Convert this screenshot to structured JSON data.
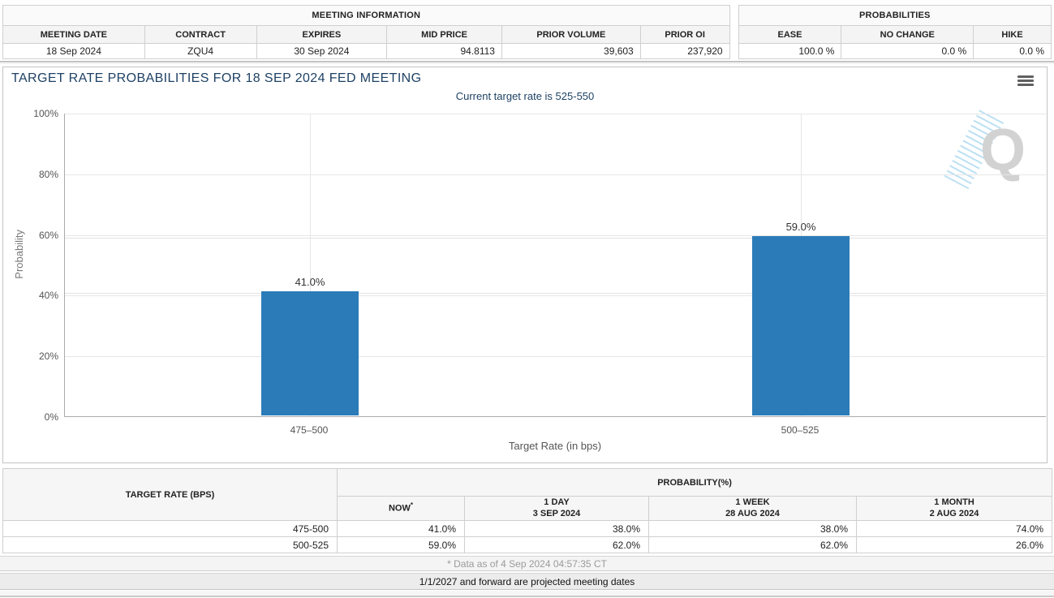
{
  "meeting_information": {
    "title": "MEETING INFORMATION",
    "columns": [
      "MEETING DATE",
      "CONTRACT",
      "EXPIRES",
      "MID PRICE",
      "PRIOR VOLUME",
      "PRIOR OI"
    ],
    "values": [
      "18 Sep 2024",
      "ZQU4",
      "30 Sep 2024",
      "94.8113",
      "39,603",
      "237,920"
    ]
  },
  "probabilities_summary": {
    "title": "PROBABILITIES",
    "columns": [
      "EASE",
      "NO CHANGE",
      "HIKE"
    ],
    "values": [
      "100.0 %",
      "0.0 %",
      "0.0 %"
    ]
  },
  "chart": {
    "title": "TARGET RATE PROBABILITIES FOR 18 SEP 2024 FED MEETING",
    "subtitle": "Current target rate is 525-550",
    "watermark_letter": "Q",
    "menu_icon": "hamburger-menu-icon"
  },
  "chart_data": {
    "type": "bar",
    "categories": [
      "475–500",
      "500–525"
    ],
    "values": [
      41.0,
      59.0
    ],
    "bar_labels": [
      "41.0%",
      "59.0%"
    ],
    "title": "TARGET RATE PROBABILITIES FOR 18 SEP 2024 FED MEETING",
    "subtitle": "Current target rate is 525-550",
    "xlabel": "Target Rate (in bps)",
    "ylabel": "Probability",
    "ylim": [
      0,
      100
    ],
    "yticks": [
      "0%",
      "20%",
      "40%",
      "60%",
      "80%",
      "100%"
    ],
    "grid": true,
    "legend": "none",
    "bar_color": "#2b7bb8"
  },
  "history_table": {
    "rate_header": "TARGET RATE (BPS)",
    "group_header": "PROBABILITY(%)",
    "now_label": "NOW",
    "now_footnote_mark": "*",
    "day_label": "1 DAY",
    "day_date": "3 SEP 2024",
    "week_label": "1 WEEK",
    "week_date": "28 AUG 2024",
    "month_label": "1 MONTH",
    "month_date": "2 AUG 2024",
    "rows": [
      {
        "rate": "475-500",
        "now": "41.0%",
        "one_day": "38.0%",
        "one_week": "38.0%",
        "one_month": "74.0%"
      },
      {
        "rate": "500-525",
        "now": "59.0%",
        "one_day": "62.0%",
        "one_week": "62.0%",
        "one_month": "26.0%"
      }
    ],
    "footnote": "* Data as of 4 Sep 2024 04:57:35 CT",
    "note": "1/1/2027 and forward are projected meeting dates"
  },
  "colors": {
    "bar": "#2b7bb8",
    "now_highlight": "#f8f8d2",
    "title_navy": "#1e4164"
  }
}
